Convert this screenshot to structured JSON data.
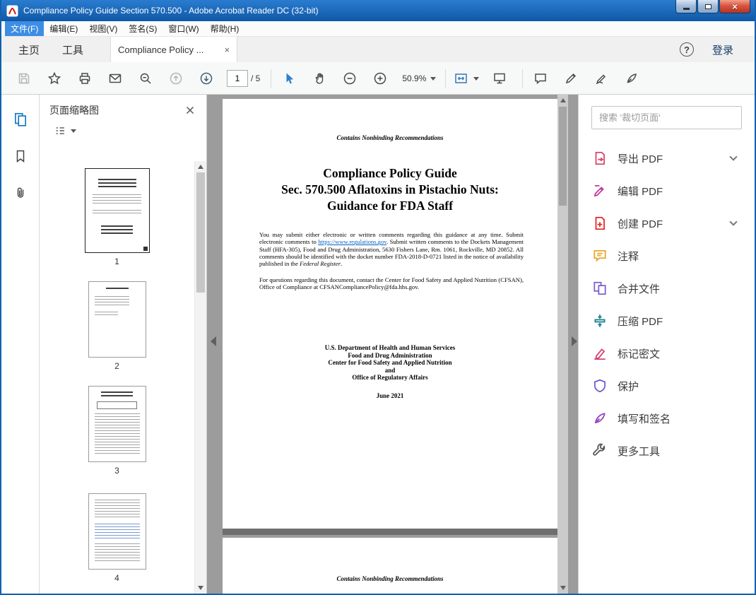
{
  "colors": {
    "titlebar_blue": "#1161ae",
    "menu_highlight": "#3d8de4",
    "doc_link_blue": "#0563c1",
    "active_rail_icon": "#0f79c0"
  },
  "icons": {
    "close": "×",
    "help": "?"
  },
  "titlebar": {
    "title": "Compliance Policy Guide Section 570.500 - Adobe Acrobat Reader DC (32-bit)"
  },
  "menubar": {
    "items": [
      "文件(F)",
      "编辑(E)",
      "视图(V)",
      "签名(S)",
      "窗口(W)",
      "帮助(H)"
    ]
  },
  "tabbar": {
    "home": "主页",
    "tools": "工具",
    "doc_tab": "Compliance Policy ...",
    "login": "登录"
  },
  "toolbar": {
    "page_value": "1",
    "page_total": "/ 5",
    "zoom_value": "50.9%"
  },
  "thumb_panel": {
    "title": "页面缩略图",
    "page_numbers": [
      "1",
      "2",
      "3",
      "4"
    ]
  },
  "document": {
    "page1": {
      "nonbinding": "Contains Nonbinding Recommendations",
      "title_line1": "Compliance Policy Guide",
      "title_line2": "Sec. 570.500 Aflatoxins in Pistachio Nuts:",
      "title_line3": "Guidance for FDA Staff",
      "para1_before_link": "You may submit either electronic or written comments regarding this guidance at any time. Submit electronic comments to ",
      "para1_link": "https://www.regulations.gov",
      "para1_after_link": ".  Submit written comments to the Dockets Management Staff (HFA-305), Food and Drug Administration, 5630 Fishers Lane, Rm. 1061, Rockville, MD 20852.  All comments should be identified with the docket number FDA-2018-D-0721 listed in the notice of availability published in the ",
      "para1_italic": "Federal Register",
      "para1_end": ".",
      "para2": "For questions regarding this document, contact the Center for Food Safety and Applied Nutrition (CFSAN), Office of Compliance at CFSANCompliancePolicy@fda.hhs.gov.",
      "org_line1": "U.S. Department of Health and Human Services",
      "org_line2": "Food and Drug Administration",
      "org_line3": "Center for Food Safety and Applied Nutrition",
      "org_line4": "and",
      "org_line5": "Office of Regulatory Affairs",
      "date": "June 2021"
    },
    "page2": {
      "nonbinding": "Contains Nonbinding Recommendations"
    }
  },
  "right_panel": {
    "search_placeholder": "搜索 '裁切页面'",
    "tools": [
      {
        "label": "导出 PDF",
        "icon": "export-pdf-icon",
        "color": "#d6456e",
        "chevron": true
      },
      {
        "label": "编辑 PDF",
        "icon": "edit-pdf-icon",
        "color": "#c2399f",
        "chevron": false
      },
      {
        "label": "创建 PDF",
        "icon": "create-pdf-icon",
        "color": "#e12725",
        "chevron": true
      },
      {
        "label": "注释",
        "icon": "comment-icon",
        "color": "#e9a82a",
        "chevron": false
      },
      {
        "label": "合并文件",
        "icon": "combine-files-icon",
        "color": "#7a5fd0",
        "chevron": false
      },
      {
        "label": "压缩 PDF",
        "icon": "compress-pdf-icon",
        "color": "#1a7f8e",
        "chevron": false
      },
      {
        "label": "标记密文",
        "icon": "redact-icon",
        "color": "#d63d6f",
        "chevron": false
      },
      {
        "label": "保护",
        "icon": "protect-icon",
        "color": "#6a5acd",
        "chevron": false
      },
      {
        "label": "填写和签名",
        "icon": "fill-sign-icon",
        "color": "#9340bf",
        "chevron": false
      },
      {
        "label": "更多工具",
        "icon": "more-tools-icon",
        "color": "#555555",
        "chevron": false
      }
    ]
  }
}
